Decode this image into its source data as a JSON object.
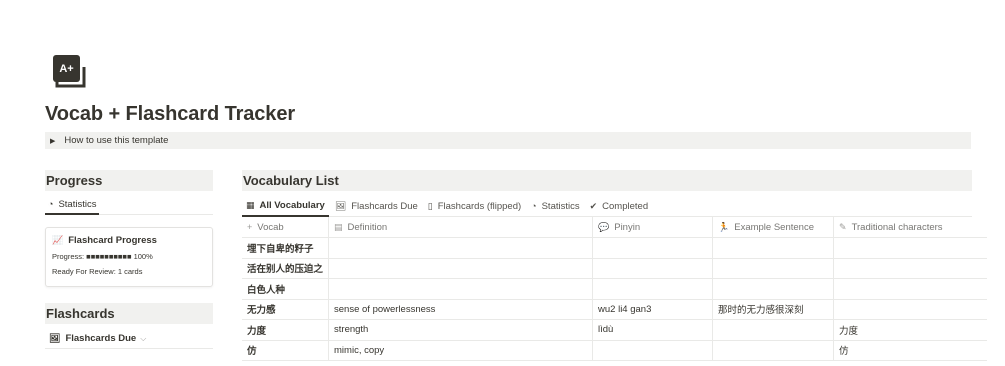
{
  "page": {
    "icon": "flashcard-aplus-icon",
    "icon_text": "A+",
    "title": "Vocab + Flashcard Tracker",
    "toggle_label": "How to use this template"
  },
  "progress": {
    "heading": "Progress",
    "tab_label": "Statistics",
    "card_title": "Flashcard Progress",
    "progress_line": "Progress: ■■■■■■■■■■ 100%",
    "review_line": "Ready For Review: 1 cards"
  },
  "flashcards": {
    "heading": "Flashcards",
    "view_label": "Flashcards Due"
  },
  "vocab": {
    "heading": "Vocabulary List",
    "tabs": [
      {
        "label": "All Vocabulary",
        "icon": "table-icon"
      },
      {
        "label": "Flashcards Due",
        "icon": "gallery-icon"
      },
      {
        "label": "Flashcards (flipped)",
        "icon": "card-icon"
      },
      {
        "label": "Statistics",
        "icon": "chart-icon"
      },
      {
        "label": "Completed",
        "icon": "check-circle-icon"
      }
    ],
    "columns": [
      {
        "label": "Vocab",
        "icon": "plus-icon"
      },
      {
        "label": "Definition",
        "icon": "text-icon"
      },
      {
        "label": "Pinyin",
        "icon": "speech-icon"
      },
      {
        "label": "Example Sentence",
        "icon": "runner-icon"
      },
      {
        "label": "Traditional characters",
        "icon": "brush-icon"
      }
    ],
    "rows": [
      {
        "vocab": "埋下自卑的籽子",
        "definition": "",
        "pinyin": "",
        "example": "",
        "traditional": ""
      },
      {
        "vocab": "活在别人的压迫之",
        "definition": "",
        "pinyin": "",
        "example": "",
        "traditional": ""
      },
      {
        "vocab": "白色人种",
        "definition": "",
        "pinyin": "",
        "example": "",
        "traditional": ""
      },
      {
        "vocab": "无力感",
        "definition": "sense of powerlessness",
        "pinyin": "wu2 li4 gan3",
        "example": "那时的无力感很深刻",
        "traditional": ""
      },
      {
        "vocab": "力度",
        "definition": "strength",
        "pinyin": "lìdù",
        "example": "",
        "traditional": "力度"
      },
      {
        "vocab": "仿",
        "definition": "mimic, copy",
        "pinyin": "",
        "example": "",
        "traditional": "仿"
      }
    ]
  }
}
